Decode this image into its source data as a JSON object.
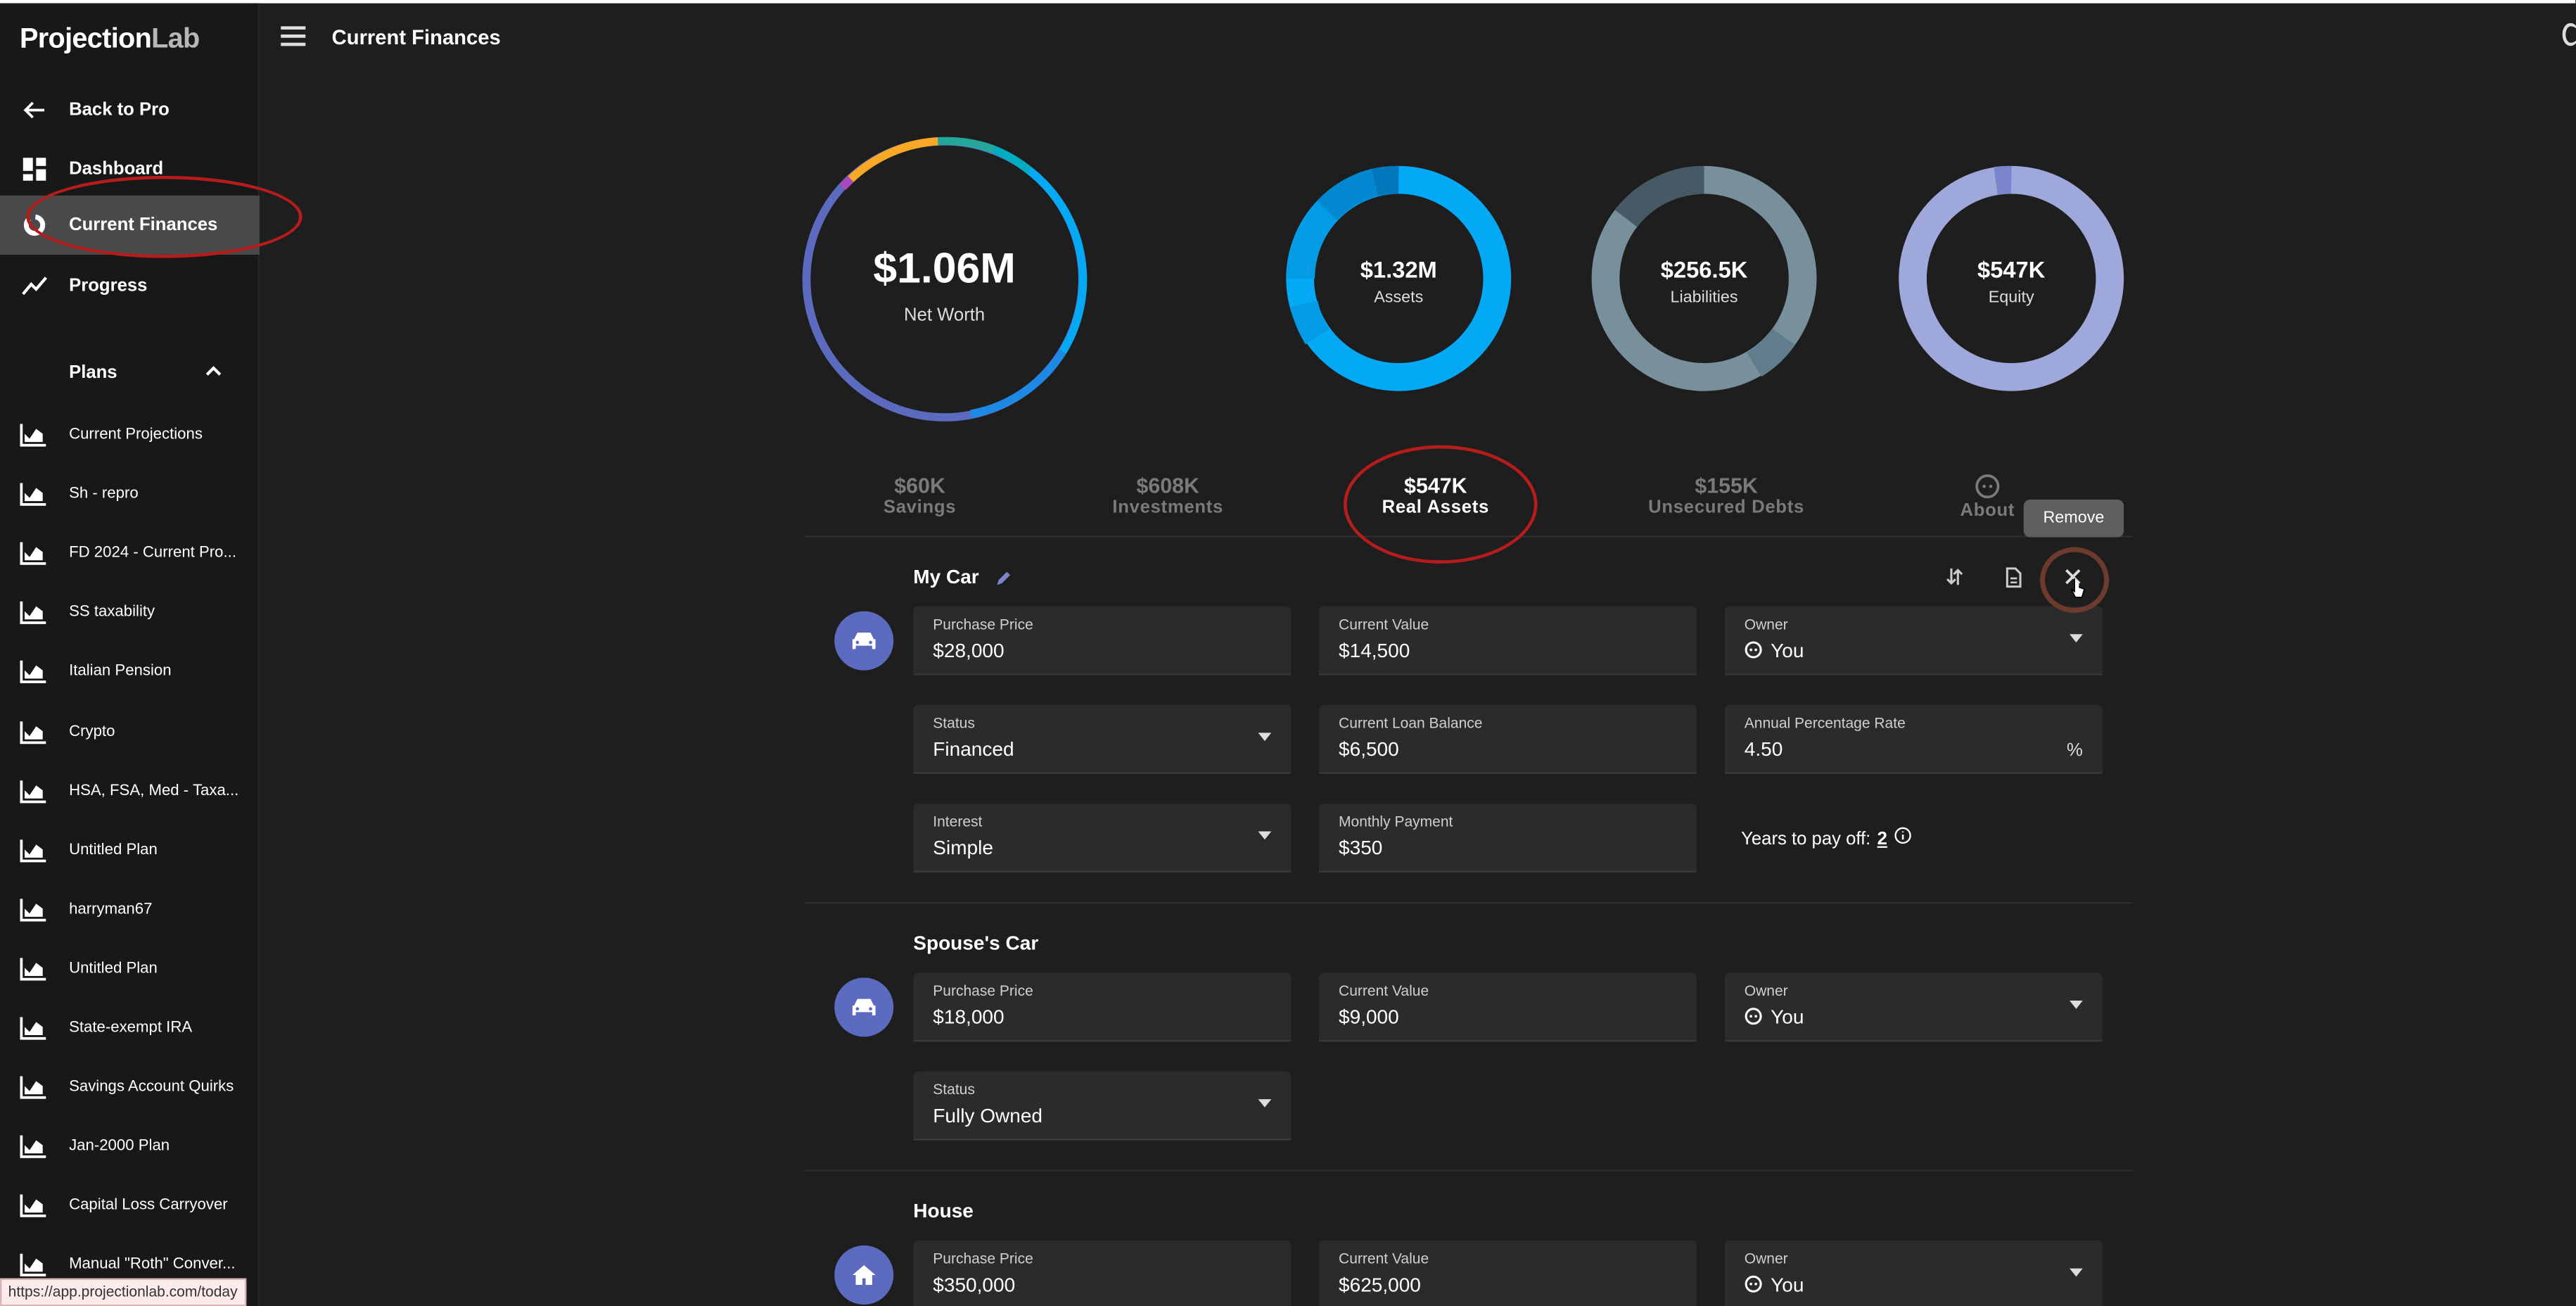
{
  "app": {
    "logo_main": "Projection",
    "logo_accent": "Lab",
    "page_title": "Current Finances"
  },
  "sidebar": {
    "nav": [
      {
        "label": "Back to Pro",
        "icon": "arrow-left-icon"
      },
      {
        "label": "Dashboard",
        "icon": "dashboard-icon"
      },
      {
        "label": "Current Finances",
        "icon": "donut-icon",
        "active": true
      },
      {
        "label": "Progress",
        "icon": "trending-icon"
      }
    ],
    "plans_label": "Plans",
    "plans": [
      "Current Projections",
      "Sh - repro",
      "FD 2024 - Current Pro...",
      "SS taxability",
      "Italian Pension",
      "Crypto",
      "HSA, FSA, Med - Taxa...",
      "Untitled Plan",
      "harryman67",
      "Untitled Plan",
      "State-exempt IRA",
      "Savings Account Quirks",
      "Jan-2000 Plan",
      "Capital Loss Carryover",
      "Manual \"Roth\" Conver..."
    ]
  },
  "summary": {
    "net_worth": {
      "value": "$1.06M",
      "label": "Net Worth"
    },
    "assets": {
      "value": "$1.32M",
      "label": "Assets"
    },
    "liabilities": {
      "value": "$256.5K",
      "label": "Liabilities"
    },
    "equity": {
      "value": "$547K",
      "label": "Equity"
    }
  },
  "tabs": [
    {
      "value": "$60K",
      "label": "Savings"
    },
    {
      "value": "$608K",
      "label": "Investments"
    },
    {
      "value": "$547K",
      "label": "Real Assets",
      "selected": true
    },
    {
      "value": "$155K",
      "label": "Unsecured Debts"
    },
    {
      "value": "",
      "label": "About"
    }
  ],
  "tooltip": "Remove",
  "assets": [
    {
      "name": "My Car",
      "purchase_price_label": "Purchase Price",
      "purchase_price": "$28,000",
      "current_value_label": "Current Value",
      "current_value": "$14,500",
      "owner_label": "Owner",
      "owner": "You",
      "status_label": "Status",
      "status": "Financed",
      "loan_label": "Current Loan Balance",
      "loan": "$6,500",
      "apr_label": "Annual Percentage Rate",
      "apr": "4.50",
      "apr_suffix": "%",
      "interest_label": "Interest",
      "interest": "Simple",
      "payment_label": "Monthly Payment",
      "payment": "$350",
      "years_label": "Years to pay off:",
      "years": "2"
    },
    {
      "name": "Spouse's Car",
      "purchase_price_label": "Purchase Price",
      "purchase_price": "$18,000",
      "current_value_label": "Current Value",
      "current_value": "$9,000",
      "owner_label": "Owner",
      "owner": "You",
      "status_label": "Status",
      "status": "Fully Owned"
    },
    {
      "name": "House",
      "purchase_price_label": "Purchase Price",
      "purchase_price": "$350,000",
      "current_value_label": "Current Value",
      "current_value": "$625,000",
      "owner_label": "Owner",
      "owner": "You"
    }
  ],
  "status_url": "https://app.projectionlab.com/today",
  "colors": {
    "accent": "#5c6bc0",
    "assets_blue": "#03a9f4",
    "liabilities_gray": "#78909c",
    "equity_lavender": "#9fa8da",
    "annotation_red": "#b71c1c"
  }
}
